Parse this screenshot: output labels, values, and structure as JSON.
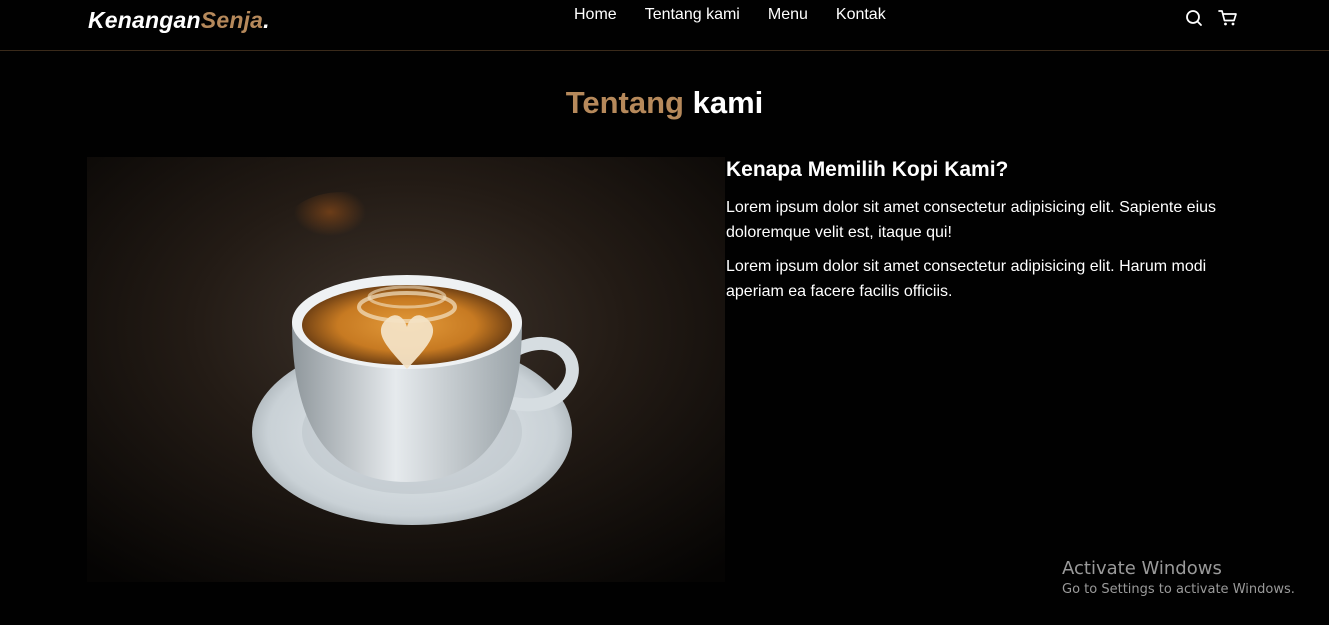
{
  "brand": {
    "name_main": "Kenangan",
    "name_accent": "Senja",
    "name_dot": ".",
    "accent_color": "#b6895b"
  },
  "nav": {
    "items": [
      "Home",
      "Tentang kami",
      "Menu",
      "Kontak"
    ]
  },
  "nav_icons": [
    "search-icon",
    "cart-icon"
  ],
  "about": {
    "title_accent": "Tentang",
    "title_rest": "kami",
    "heading": "Kenapa Memilih Kopi Kami?",
    "paragraphs": [
      "Lorem ipsum dolor sit amet consectetur adipisicing elit. Sapiente eius doloremque velit est, itaque qui!",
      "Lorem ipsum dolor sit amet consectetur adipisicing elit. Harum modi aperiam ea facere facilis officiis."
    ]
  },
  "watermark": {
    "line1": "Activate Windows",
    "line2": "Go to Settings to activate Windows."
  }
}
